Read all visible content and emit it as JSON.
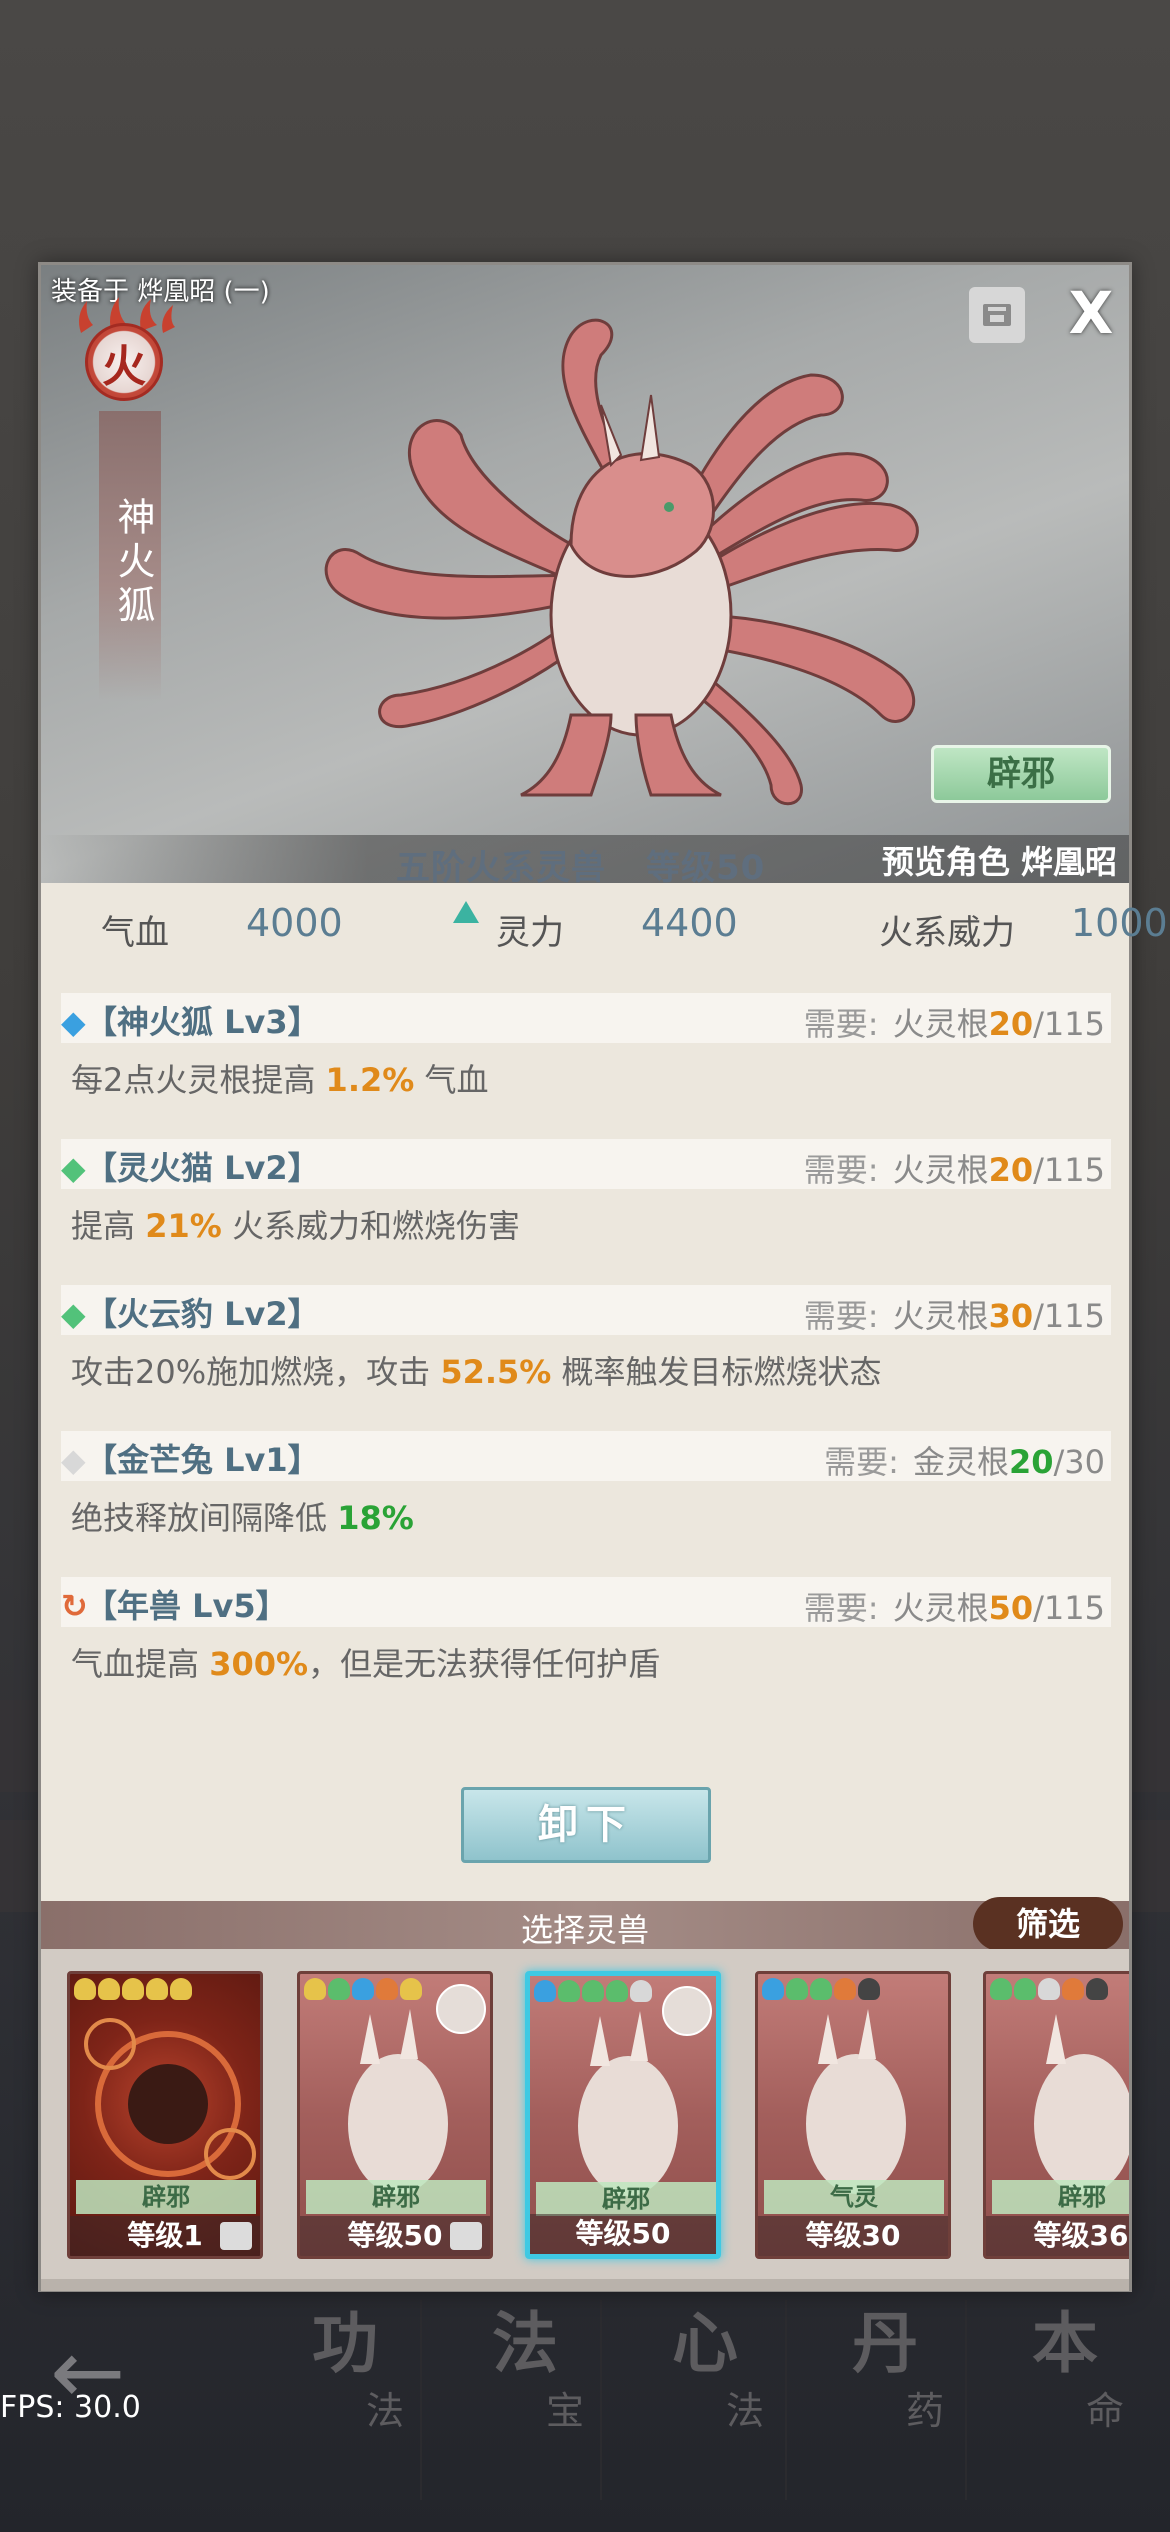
{
  "header": {
    "equip_label": "装备于 烨凰昭 (一)",
    "close_label": "X"
  },
  "beast": {
    "element": "火",
    "name": "神火狐",
    "tag_button": "辟邪",
    "rank": "五阶火系灵兽",
    "level": "等级50",
    "preview": "预览角色 烨凰昭"
  },
  "stats": {
    "hp_label": "气血",
    "hp_value": "4000",
    "spirit_label": "灵力",
    "spirit_value": "4400",
    "fire_label": "火系威力",
    "fire_value": "1000"
  },
  "skills": [
    {
      "mark": "◆",
      "mark_color": "#3aa0e0",
      "title": "【神火狐 Lv3】",
      "need": "需要:",
      "root": "火灵根",
      "cur": "20",
      "cur_color": "#e08a1a",
      "max": "/115",
      "desc_pre": "每2点火灵根提高 ",
      "desc_hl": "1.2%",
      "desc_post": " 气血",
      "hl_color": "orange"
    },
    {
      "mark": "◆",
      "mark_color": "#52c27a",
      "title": "【灵火猫 Lv2】",
      "need": "需要:",
      "root": "火灵根",
      "cur": "20",
      "cur_color": "#e08a1a",
      "max": "/115",
      "desc_pre": "提高 ",
      "desc_hl": "21%",
      "desc_post": " 火系威力和燃烧伤害",
      "hl_color": "orange"
    },
    {
      "mark": "◆",
      "mark_color": "#52c27a",
      "title": "【火云豹 Lv2】",
      "need": "需要:",
      "root": "火灵根",
      "cur": "30",
      "cur_color": "#e08a1a",
      "max": "/115",
      "desc_pre": "攻击20%施加燃烧，攻击 ",
      "desc_hl": "52.5%",
      "desc_post": " 概率触发目标燃烧状态",
      "hl_color": "orange"
    },
    {
      "mark": "◆",
      "mark_color": "#d8d8d8",
      "title": "【金芒兔 Lv1】",
      "need": "需要:",
      "root": "金灵根",
      "cur": "20",
      "cur_color": "#2aa336",
      "max": "/30",
      "desc_pre": "绝技释放间隔降低 ",
      "desc_hl": "18%",
      "desc_post": "",
      "hl_color": "green"
    },
    {
      "mark": "↻",
      "mark_color": "#e06a3a",
      "title": "【年兽 Lv5】",
      "need": "需要:",
      "root": "火灵根",
      "cur": "50",
      "cur_color": "#e08a1a",
      "max": "/115",
      "desc_pre": "气血提高 ",
      "desc_hl": "300%",
      "desc_post": "，但是无法获得任何护盾",
      "hl_color": "orange"
    }
  ],
  "unequip_label": "卸下",
  "select": {
    "title": "选择灵兽",
    "filter": "筛选"
  },
  "cards": [
    {
      "tag": "辟邪",
      "level": "等级1",
      "gems": [
        "#e6c34a",
        "#e6c34a",
        "#e6c34a",
        "#e6c34a",
        "#e6c34a"
      ],
      "selected": false,
      "fire": true,
      "portrait": false,
      "lock": true
    },
    {
      "tag": "辟邪",
      "level": "等级50",
      "gems": [
        "#e6c34a",
        "#5bbd6c",
        "#3aa0e0",
        "#e07a3a",
        "#e6c34a"
      ],
      "selected": false,
      "fire": false,
      "portrait": true,
      "lock": true
    },
    {
      "tag": "辟邪",
      "level": "等级50",
      "gems": [
        "#3aa0e0",
        "#5bbd6c",
        "#5bbd6c",
        "#5bbd6c",
        "#d8d8d8"
      ],
      "selected": true,
      "fire": false,
      "portrait": true,
      "lock": false
    },
    {
      "tag": "气灵",
      "level": "等级30",
      "gems": [
        "#3aa0e0",
        "#5bbd6c",
        "#5bbd6c",
        "#e07a3a",
        "#444444"
      ],
      "selected": false,
      "fire": false,
      "portrait": false,
      "lock": false
    },
    {
      "tag": "辟邪",
      "level": "等级36",
      "gems": [
        "#5bbd6c",
        "#5bbd6c",
        "#d8d8d8",
        "#e07a3a",
        "#444444"
      ],
      "selected": false,
      "fire": false,
      "portrait": false,
      "lock": false
    }
  ],
  "nav": {
    "items": [
      {
        "big": "功",
        "small": "法"
      },
      {
        "big": "法",
        "small": "宝"
      },
      {
        "big": "心",
        "small": "法"
      },
      {
        "big": "丹",
        "small": "药"
      },
      {
        "big": "本",
        "small": "命"
      }
    ]
  },
  "fps": "FPS: 30.0",
  "colors": {
    "accent_blue": "#5b7d92",
    "orange": "#e08a1a",
    "green": "#2aa336"
  }
}
